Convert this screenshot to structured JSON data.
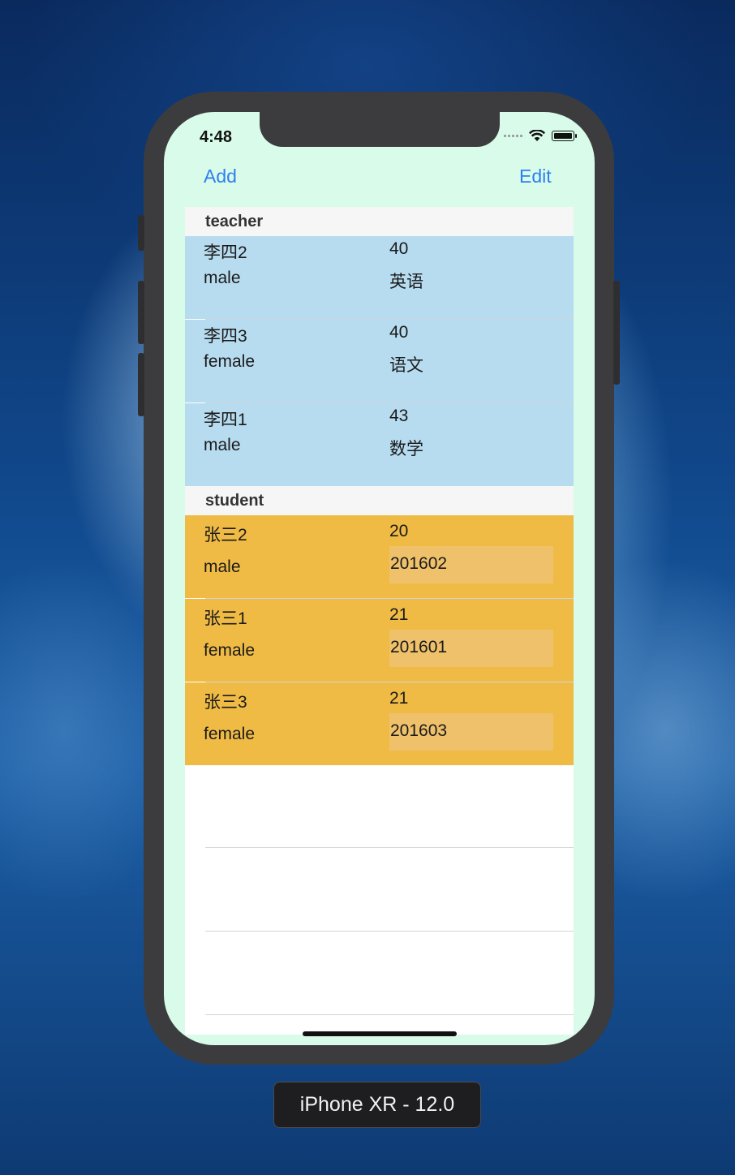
{
  "status_bar": {
    "time": "4:48"
  },
  "nav": {
    "add_label": "Add",
    "edit_label": "Edit"
  },
  "sections": [
    {
      "title": "teacher",
      "rows": [
        {
          "name": "李四2",
          "age": "40",
          "gender": "male",
          "subject": "英语"
        },
        {
          "name": "李四3",
          "age": "40",
          "gender": "female",
          "subject": "语文"
        },
        {
          "name": "李四1",
          "age": "43",
          "gender": "male",
          "subject": "数学"
        }
      ]
    },
    {
      "title": "student",
      "rows": [
        {
          "name": "张三2",
          "age": "20",
          "gender": "male",
          "number": "201602"
        },
        {
          "name": "张三1",
          "age": "21",
          "gender": "female",
          "number": "201601"
        },
        {
          "name": "张三3",
          "age": "21",
          "gender": "female",
          "number": "201603"
        }
      ]
    }
  ],
  "simulator": {
    "device_label": "iPhone XR - 12.0"
  },
  "colors": {
    "nav_tint": "#2f7ff0",
    "teacher_row": "#b7dcf0",
    "student_row": "#f0bb45",
    "student_number_field": "#efc16a",
    "screen_background": "#d8fbea",
    "section_header": "#f6f6f6"
  }
}
